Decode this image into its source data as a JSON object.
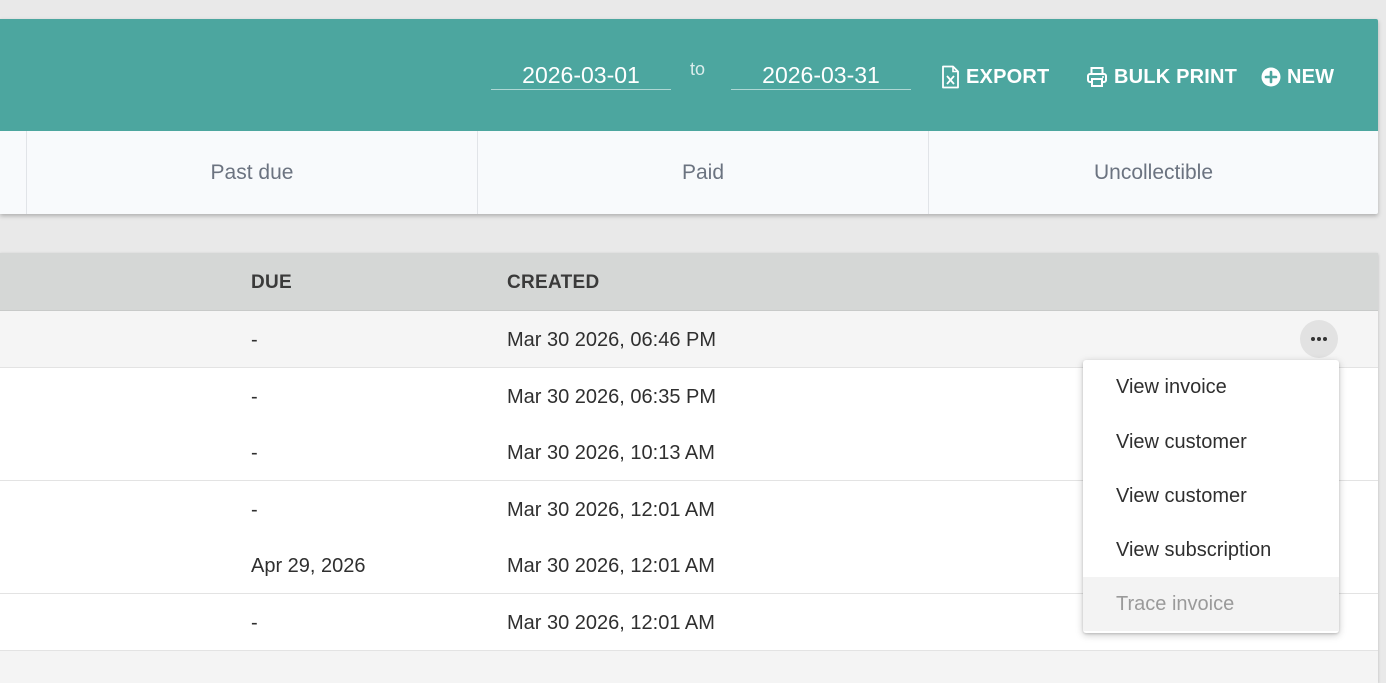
{
  "header": {
    "date_from": "2026-03-01",
    "to_label": "to",
    "date_to": "2026-03-31",
    "export_label": "EXPORT",
    "bulk_print_label": "BULK PRINT",
    "new_label": "NEW",
    "accent_color": "#4ca69f"
  },
  "status_tabs": [
    {
      "label": "Past due"
    },
    {
      "label": "Paid"
    },
    {
      "label": "Uncollectible"
    }
  ],
  "table": {
    "columns": {
      "due": "DUE",
      "created": "CREATED"
    },
    "rows": [
      {
        "due": "-",
        "created": "Mar 30 2026, 06:46 PM"
      },
      {
        "due": "-",
        "created": "Mar 30 2026, 06:35 PM"
      },
      {
        "due": "-",
        "created": "Mar 30 2026, 10:13 AM"
      },
      {
        "due": "-",
        "created": "Mar 30 2026, 12:01 AM"
      },
      {
        "due": "Apr 29, 2026",
        "created": "Mar 30 2026, 12:01 AM"
      },
      {
        "due": "-",
        "created": "Mar 30 2026, 12:01 AM"
      }
    ]
  },
  "row_menu": {
    "items": [
      {
        "label": "View invoice"
      },
      {
        "label": "View customer"
      },
      {
        "label": "View customer"
      },
      {
        "label": "View subscription"
      },
      {
        "label": "Trace invoice"
      }
    ]
  }
}
